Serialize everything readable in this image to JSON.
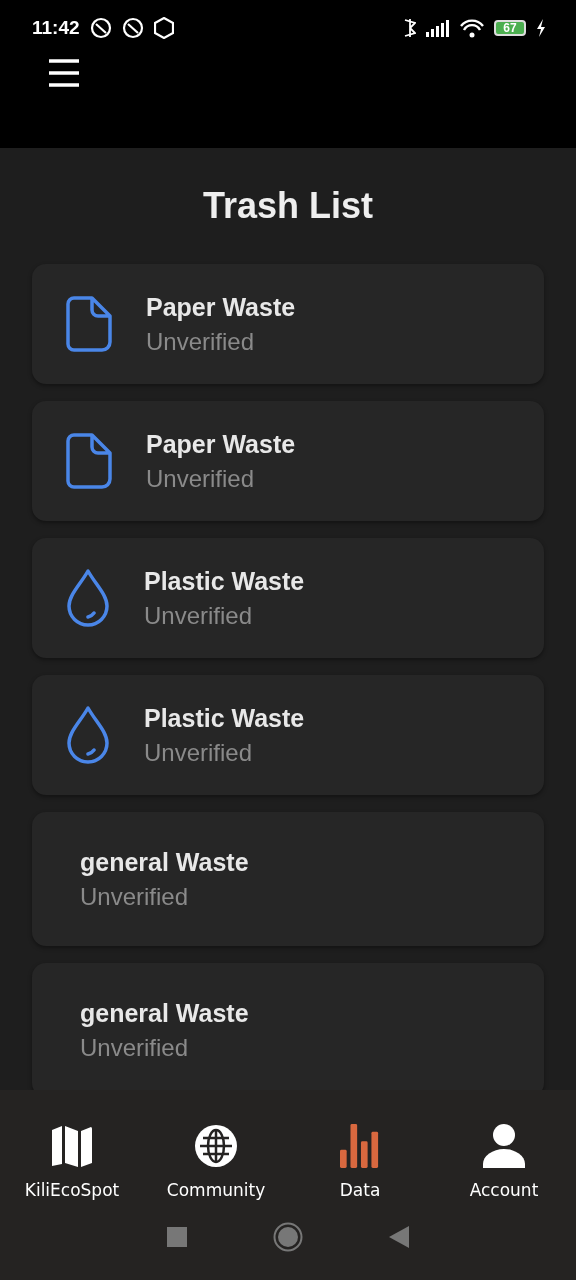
{
  "status_bar": {
    "time": "11:42",
    "battery": "67"
  },
  "title": "Trash List",
  "items": [
    {
      "kind": "paper",
      "name": "Paper Waste",
      "status": "Unverified"
    },
    {
      "kind": "paper",
      "name": "Paper Waste",
      "status": "Unverified"
    },
    {
      "kind": "plastic",
      "name": "Plastic Waste",
      "status": "Unverified"
    },
    {
      "kind": "plastic",
      "name": "Plastic Waste",
      "status": "Unverified"
    },
    {
      "kind": "general",
      "name": "general Waste",
      "status": "Unverified"
    },
    {
      "kind": "general",
      "name": "general Waste",
      "status": "Unverified"
    }
  ],
  "nav": [
    {
      "kind": "map",
      "label": "KiliEcoSpot",
      "selected": false
    },
    {
      "kind": "globe",
      "label": "Community",
      "selected": false
    },
    {
      "kind": "chart",
      "label": "Data",
      "selected": true
    },
    {
      "kind": "person",
      "label": "Account",
      "selected": false
    }
  ]
}
